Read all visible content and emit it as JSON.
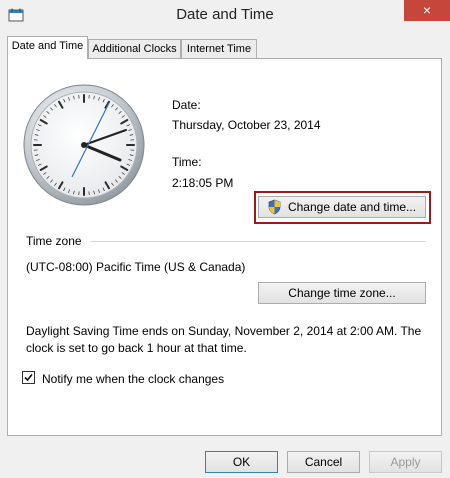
{
  "window": {
    "title": "Date and Time"
  },
  "tabs": [
    {
      "label": "Date and Time"
    },
    {
      "label": "Additional Clocks"
    },
    {
      "label": "Internet Time"
    }
  ],
  "date": {
    "label": "Date:",
    "value": "Thursday, October 23, 2014"
  },
  "time": {
    "label": "Time:",
    "value": "2:18:05 PM"
  },
  "change_datetime_button": "Change date and time...",
  "timezone": {
    "section_label": "Time zone",
    "value": "(UTC-08:00) Pacific Time (US & Canada)",
    "button": "Change time zone..."
  },
  "dst": {
    "line1": "Daylight Saving Time ends on Sunday, November 2, 2014 at 2:00 AM. The",
    "line2": "clock is set to go back 1 hour at that time."
  },
  "notify": {
    "label": "Notify me when the clock changes",
    "checked": true
  },
  "footer": {
    "ok": "OK",
    "cancel": "Cancel",
    "apply": "Apply"
  },
  "colors": {
    "close": "#c7463c",
    "highlight_frame": "#9b1b1b",
    "accent": "#3c7fb1"
  },
  "icons": {
    "app": "calendar-icon",
    "close": "close-icon",
    "shield": "uac-shield-icon",
    "check": "checkmark-icon"
  }
}
